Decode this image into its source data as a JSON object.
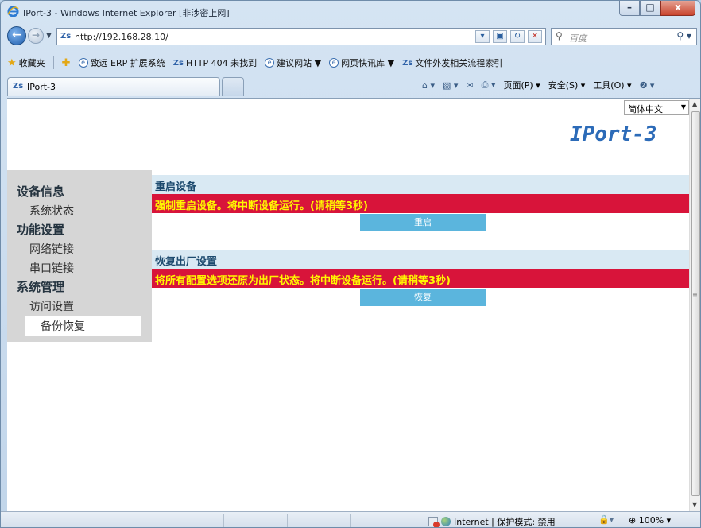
{
  "window": {
    "title": "IPort-3 - Windows Internet Explorer [非涉密上网]",
    "min": "–",
    "max": "□",
    "close": "x"
  },
  "address": {
    "url": "http://192.168.28.10/",
    "search_placeholder": "百度"
  },
  "favorites": {
    "label": "收藏夹",
    "items": [
      "致远 ERP 扩展系统",
      "HTTP 404 未找到",
      "建议网站 ▼",
      "网页快讯库 ▼",
      "文件外发相关流程索引"
    ]
  },
  "tab": {
    "label": "IPort-3"
  },
  "commandbar": {
    "page": "页面(P) ▾",
    "safety": "安全(S) ▾",
    "tools": "工具(O) ▾",
    "help": "❷ ▾"
  },
  "page": {
    "language": "简体中文",
    "brand": "IPort-3",
    "sidebar": {
      "group1": "设备信息",
      "item_status": "系统状态",
      "group2": "功能设置",
      "item_network": "网络链接",
      "item_serial": "串口链接",
      "group3": "系统管理",
      "item_access": "访问设置",
      "item_backup": "备份恢复"
    },
    "reboot": {
      "title": "重启设备",
      "warning": "强制重启设备。将中断设备运行。(请稍等3秒)",
      "button": "重启"
    },
    "restore": {
      "title": "恢复出厂设置",
      "warning": "将所有配置选项还原为出厂状态。将中断设备运行。(请稍等3秒)",
      "button": "恢复"
    }
  },
  "status": {
    "zone": "Internet | 保护模式: 禁用",
    "zoom": "100%"
  }
}
